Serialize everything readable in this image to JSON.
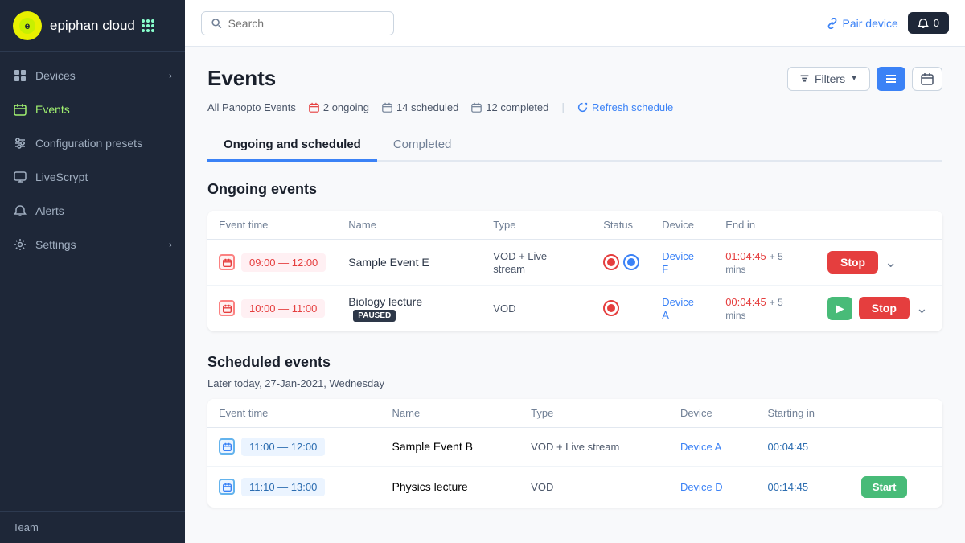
{
  "sidebar": {
    "logo": {
      "icon_text": "e",
      "brand": "epiphan cloud"
    },
    "items": [
      {
        "id": "devices",
        "label": "Devices",
        "icon": "grid",
        "has_chevron": true,
        "active": false
      },
      {
        "id": "events",
        "label": "Events",
        "icon": "calendar",
        "has_chevron": false,
        "active": true
      },
      {
        "id": "configuration",
        "label": "Configuration presets",
        "icon": "sliders",
        "has_chevron": false,
        "active": false
      },
      {
        "id": "livescrypt",
        "label": "LiveScrypt",
        "icon": "monitor",
        "has_chevron": false,
        "active": false
      },
      {
        "id": "alerts",
        "label": "Alerts",
        "icon": "bell",
        "has_chevron": false,
        "active": false
      },
      {
        "id": "settings",
        "label": "Settings",
        "icon": "gear",
        "has_chevron": true,
        "active": false
      }
    ],
    "footer_label": "Team"
  },
  "topbar": {
    "search_placeholder": "Search",
    "pair_device_label": "Pair device",
    "notification_count": "0"
  },
  "page": {
    "title": "Events",
    "filter_label": "Filters",
    "meta": {
      "all_label": "All Panopto Events",
      "ongoing_count": "2 ongoing",
      "scheduled_count": "14 scheduled",
      "completed_count": "12 completed",
      "refresh_label": "Refresh schedule"
    },
    "tabs": [
      {
        "id": "ongoing",
        "label": "Ongoing and scheduled",
        "active": true
      },
      {
        "id": "completed",
        "label": "Completed",
        "active": false
      }
    ],
    "ongoing_section_title": "Ongoing events",
    "columns": {
      "event_time": "Event time",
      "name": "Name",
      "type": "Type",
      "status": "Status",
      "device": "Device",
      "end_in": "End in"
    },
    "ongoing_events": [
      {
        "time_start": "09:00",
        "time_end": "12:00",
        "name": "Sample Event E",
        "type": "VOD + Live-stream",
        "device": "Device F",
        "end_in": "01:04:45",
        "plus_mins": "+ 5 mins",
        "has_live": true,
        "paused": false,
        "stop_label": "Stop"
      },
      {
        "time_start": "10:00",
        "time_end": "11:00",
        "name": "Biology lecture",
        "paused_badge": "PAUSED",
        "type": "VOD",
        "device": "Device A",
        "end_in": "00:04:45",
        "plus_mins": "+ 5 mins",
        "has_live": false,
        "paused": true,
        "stop_label": "Stop"
      }
    ],
    "scheduled_section_title": "Scheduled events",
    "date_label": "Later today, 27-Jan-2021, Wednesday",
    "scheduled_columns": {
      "event_time": "Event time",
      "name": "Name",
      "type": "Type",
      "device": "Device",
      "starting_in": "Starting in"
    },
    "scheduled_events": [
      {
        "time_start": "11:00",
        "time_end": "12:00",
        "name": "Sample Event B",
        "type": "VOD + Live stream",
        "device": "Device A",
        "starting_in": "00:04:45"
      },
      {
        "time_start": "11:10",
        "time_end": "13:00",
        "name": "Physics lecture",
        "type": "VOD",
        "device": "Device D",
        "starting_in": "00:14:45",
        "has_start_btn": true,
        "start_label": "Start"
      }
    ]
  }
}
